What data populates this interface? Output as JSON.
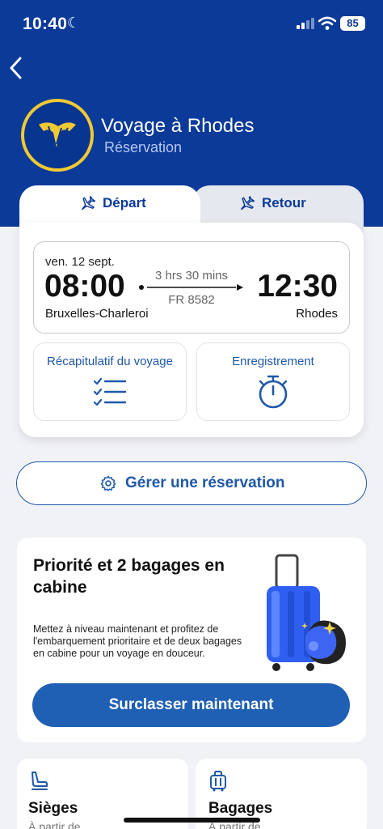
{
  "status_bar": {
    "time": "10:40",
    "battery": "85"
  },
  "header": {
    "title": "Voyage à Rhodes",
    "subtitle": "Réservation"
  },
  "tabs": [
    {
      "label": "Départ",
      "active": true
    },
    {
      "label": "Retour",
      "active": false
    }
  ],
  "flight": {
    "date": "ven. 12 sept.",
    "departure_time": "08:00",
    "arrival_time": "12:30",
    "duration": "3 hrs 30 mins",
    "flight_number": "FR 8582",
    "departure_city": "Bruxelles-Charleroi",
    "arrival_city": "Rhodes"
  },
  "actions": [
    {
      "label": "Récapitulatif du voyage",
      "icon": "checklist-icon"
    },
    {
      "label": "Enregistrement",
      "icon": "stopwatch-icon"
    }
  ],
  "manage": {
    "label": "Gérer une réservation",
    "icon": "gear-icon"
  },
  "upsell": {
    "title": "Priorité et 2 bagages en cabine",
    "description": "Mettez à niveau maintenant et profitez de l'embarquement prioritaire et de deux bagages en cabine pour un voyage en douceur.",
    "button_label": "Surclasser maintenant"
  },
  "tiles": [
    {
      "title": "Sièges",
      "subtitle": "À partir de",
      "icon": "seat-icon"
    },
    {
      "title": "Bagages",
      "subtitle": "À partir de",
      "icon": "luggage-icon"
    }
  ],
  "colors": {
    "brand_blue": "#0b3a99",
    "link_blue": "#1f58a8",
    "button_blue": "#1f5fb4",
    "gold": "#f1c933"
  }
}
